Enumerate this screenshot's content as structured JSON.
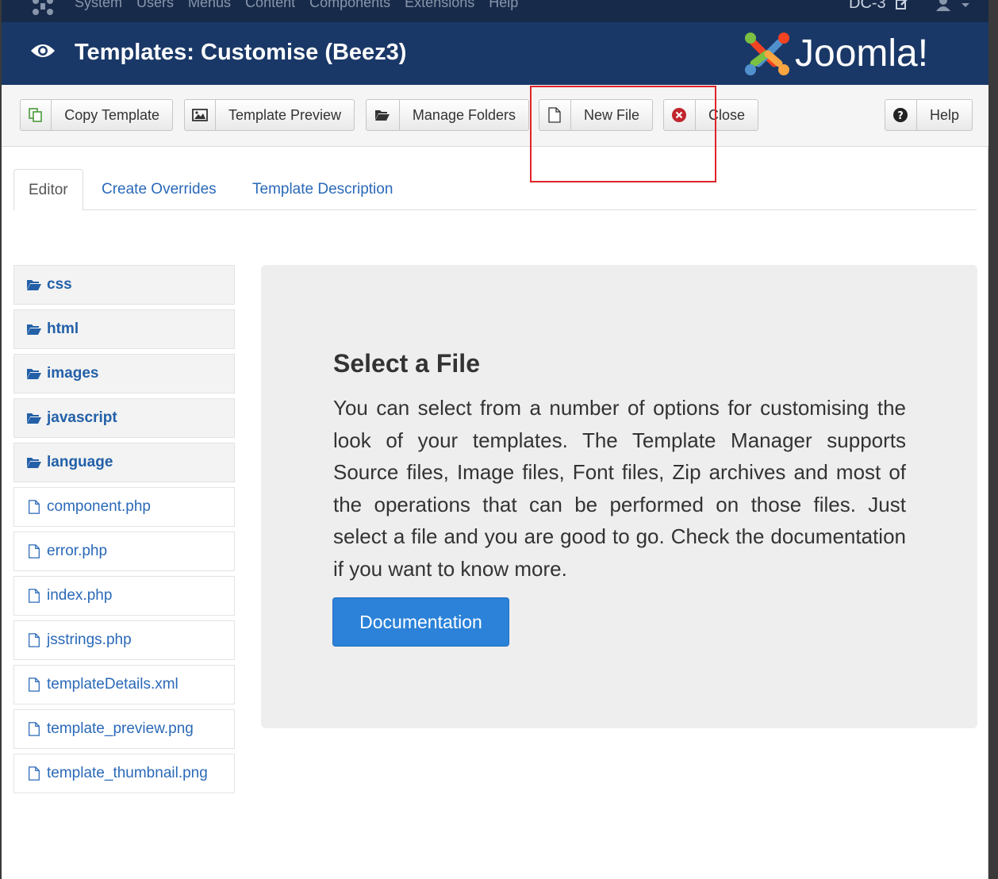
{
  "topnav": {
    "menu": [
      "System",
      "Users",
      "Menus",
      "Content",
      "Components",
      "Extensions",
      "Help"
    ],
    "site_name": "DC-3"
  },
  "header": {
    "title": "Templates: Customise (Beez3)",
    "brand": "Joomla!"
  },
  "toolbar": {
    "copy_template": "Copy Template",
    "template_preview": "Template Preview",
    "manage_folders": "Manage Folders",
    "new_file": "New File",
    "close": "Close",
    "help": "Help"
  },
  "tabs": {
    "editor": "Editor",
    "create_overrides": "Create Overrides",
    "template_description": "Template Description"
  },
  "tree": {
    "folders": [
      "css",
      "html",
      "images",
      "javascript",
      "language"
    ],
    "files": [
      "component.php",
      "error.php",
      "index.php",
      "jsstrings.php",
      "templateDetails.xml",
      "template_preview.png",
      "template_thumbnail.png"
    ]
  },
  "panel": {
    "heading": "Select a File",
    "body": "You can select from a number of options for customising the look of your templates. The Template Manager supports Source files, Image files, Font files, Zip archives and most of the operations that can be performed on those files. Just select a file and you are good to go. Check the documentation if you want to know more.",
    "button": "Documentation"
  },
  "colors": {
    "header_bg": "#1a3867",
    "topnav_bg": "#172a4a",
    "link": "#2a69b8",
    "primary_button": "#2b82d8",
    "highlight_box": "#e0242a",
    "close_icon": "#c0262c"
  },
  "icons": {
    "copy": "copy-icon",
    "preview": "image-icon",
    "folders": "folder-open-icon",
    "new_file": "file-icon",
    "close": "close-circle-icon",
    "help": "question-circle-icon"
  }
}
